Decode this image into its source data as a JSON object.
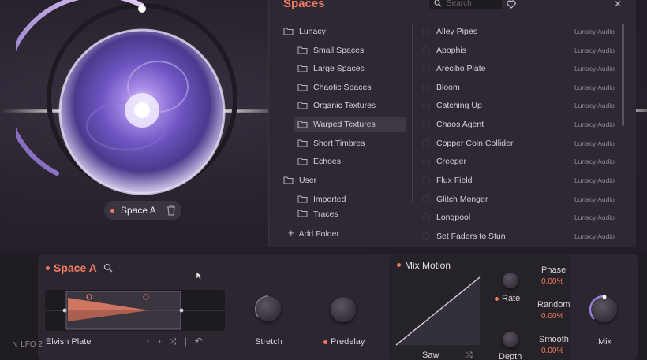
{
  "browser": {
    "title": "Spaces",
    "search_placeholder": "Search",
    "folders": [
      {
        "label": "Lunacy",
        "level": 0
      },
      {
        "label": "Small Spaces",
        "level": 1
      },
      {
        "label": "Large Spaces",
        "level": 1
      },
      {
        "label": "Chaotic Spaces",
        "level": 1
      },
      {
        "label": "Organic Textures",
        "level": 1
      },
      {
        "label": "Warped Textures",
        "level": 1,
        "selected": true
      },
      {
        "label": "Short Timbres",
        "level": 1
      },
      {
        "label": "Echoes",
        "level": 1
      },
      {
        "label": "User",
        "level": 0
      },
      {
        "label": "Imported",
        "level": 1
      },
      {
        "label": "Traces",
        "level": 1
      }
    ],
    "presets": [
      {
        "name": "Alley Pipes",
        "vendor": "Lunacy Audio"
      },
      {
        "name": "Apophis",
        "vendor": "Lunacy Audio"
      },
      {
        "name": "Arecibo Plate",
        "vendor": "Lunacy Audio"
      },
      {
        "name": "Bloom",
        "vendor": "Lunacy Audio"
      },
      {
        "name": "Catching Up",
        "vendor": "Lunacy Audio"
      },
      {
        "name": "Chaos Agent",
        "vendor": "Lunacy Audio"
      },
      {
        "name": "Copper Coin Collider",
        "vendor": "Lunacy Audio"
      },
      {
        "name": "Creeper",
        "vendor": "Lunacy Audio"
      },
      {
        "name": "Flux Field",
        "vendor": "Lunacy Audio"
      },
      {
        "name": "Glitch Monger",
        "vendor": "Lunacy Audio"
      },
      {
        "name": "Longpool",
        "vendor": "Lunacy Audio"
      },
      {
        "name": "Set Faders to Stun",
        "vendor": "Lunacy Audio"
      }
    ],
    "add_folder": "Add Folder"
  },
  "orb": {
    "space_label": "Space A"
  },
  "space_section": {
    "title": "Space A",
    "ir_name": "Elvish Plate",
    "stretch_label": "Stretch",
    "predelay_label": "Predelay"
  },
  "mix_motion": {
    "title": "Mix Motion",
    "wave_label": "Saw",
    "rate_label": "Rate",
    "depth_label": "Depth",
    "phase": {
      "label": "Phase",
      "value": "0.00%"
    },
    "random": {
      "label": "Random",
      "value": "0.00%"
    },
    "smooth": {
      "label": "Smooth",
      "value": "0.00%"
    }
  },
  "mix_label": "Mix",
  "lfo_label": "LFO 2",
  "colors": {
    "accent": "#f07a62",
    "bg": "#241f27",
    "panel": "#2d2831"
  }
}
